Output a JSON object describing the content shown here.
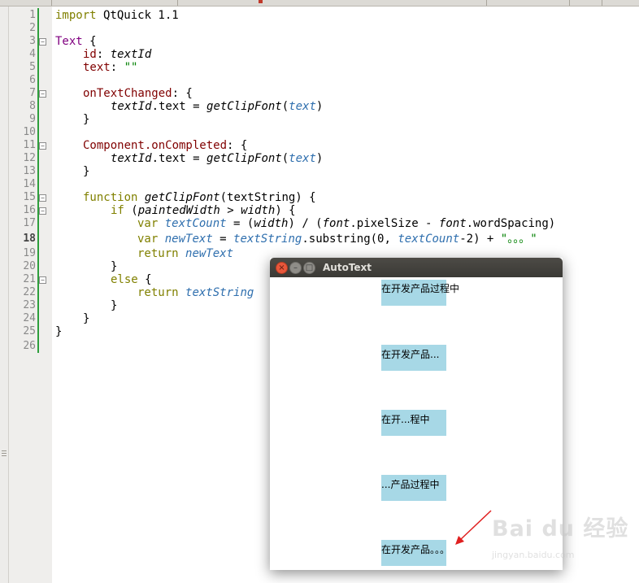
{
  "editor": {
    "line_numbers": [
      "1",
      "2",
      "3",
      "4",
      "5",
      "6",
      "7",
      "8",
      "9",
      "10",
      "11",
      "12",
      "13",
      "14",
      "15",
      "16",
      "17",
      "18",
      "19",
      "20",
      "21",
      "22",
      "23",
      "24",
      "25",
      "26"
    ],
    "current_line": "18",
    "code": {
      "l1_kw": "import",
      "l1_rest": " QtQuick 1.1",
      "l3_type": "Text",
      "l3_rest": " {",
      "l4_prop": "id",
      "l4_colon": ": ",
      "l4_val": "textId",
      "l5_prop": "text",
      "l5_colon": ": ",
      "l5_str": "\"\"",
      "l7_prop": "onTextChanged",
      "l7_rest": ": {",
      "l8_a": "textId",
      "l8_b": ".text = ",
      "l8_c": "getClipFont",
      "l8_d": "(",
      "l8_e": "text",
      "l8_f": ")",
      "l9": "}",
      "l11_prop": "Component.onCompleted",
      "l11_rest": ": {",
      "l12_a": "textId",
      "l12_b": ".text = ",
      "l12_c": "getClipFont",
      "l12_d": "(",
      "l12_e": "text",
      "l12_f": ")",
      "l13": "}",
      "l15_kw": "function",
      "l15_sp": " ",
      "l15_fn": "getClipFont",
      "l15_rest": "(textString) {",
      "l16_kw": "if",
      "l16_a": " (",
      "l16_b": "paintedWidth",
      "l16_c": " > ",
      "l16_d": "width",
      "l16_e": ") {",
      "l17_kw": "var",
      "l17_sp": " ",
      "l17_v": "textCount",
      "l17_a": " = (",
      "l17_b": "width",
      "l17_c": ") / (",
      "l17_d": "font",
      "l17_e": ".pixelSize - ",
      "l17_f": "font",
      "l17_g": ".wordSpacing)",
      "l18_kw": "var",
      "l18_sp": " ",
      "l18_v": "newText",
      "l18_a": " = ",
      "l18_b": "textString",
      "l18_c": ".substring(0, ",
      "l18_d": "textCount",
      "l18_e": "-2) + ",
      "l18_str": "\"。。。\"",
      "l19_kw": "return",
      "l19_sp": " ",
      "l19_v": "newText",
      "l20": "}",
      "l21_kw": "else",
      "l21_rest": " {",
      "l22_kw": "return",
      "l22_sp": " ",
      "l22_v": "textString",
      "l23": "}",
      "l24": "}",
      "l25": "}"
    }
  },
  "window": {
    "title": "AutoText",
    "close_glyph": "×",
    "min_glyph": "–",
    "max_glyph": "□",
    "items": [
      {
        "text": "在开发产品过程中"
      },
      {
        "text": "在开发产品..."
      },
      {
        "text": "在开...程中"
      },
      {
        "text": "...产品过程中"
      },
      {
        "text": "在开发产品。。。"
      }
    ]
  },
  "watermark": {
    "logo": "Bai du 经验",
    "url": "jingyan.baidu.com"
  },
  "colors": {
    "keyword": "#808000",
    "type": "#800080",
    "property": "#800000",
    "variable": "#2f6fae",
    "string": "#008000",
    "text_box": "#a7d8e6",
    "arrow": "#e02020"
  }
}
